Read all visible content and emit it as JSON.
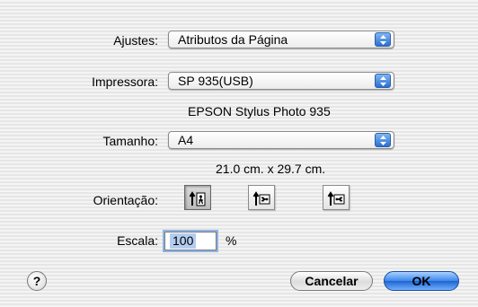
{
  "settings": {
    "label": "Ajustes:",
    "value": "Atributos da Página"
  },
  "printer": {
    "label": "Impressora:",
    "value": "SP 935(USB)",
    "model": "EPSON Stylus Photo 935"
  },
  "paper": {
    "label": "Tamanho:",
    "value": "A4",
    "dimensions": "21.0 cm. x 29.7 cm."
  },
  "orientation": {
    "label": "Orientação:",
    "options": [
      {
        "name": "portrait",
        "selected": true
      },
      {
        "name": "landscape",
        "selected": false
      },
      {
        "name": "reverse-landscape",
        "selected": false
      }
    ]
  },
  "scale": {
    "label": "Escala:",
    "value": "100",
    "unit": "%"
  },
  "buttons": {
    "help": "?",
    "cancel": "Cancelar",
    "ok": "OK"
  },
  "colors": {
    "accent": "#3a86ec"
  }
}
